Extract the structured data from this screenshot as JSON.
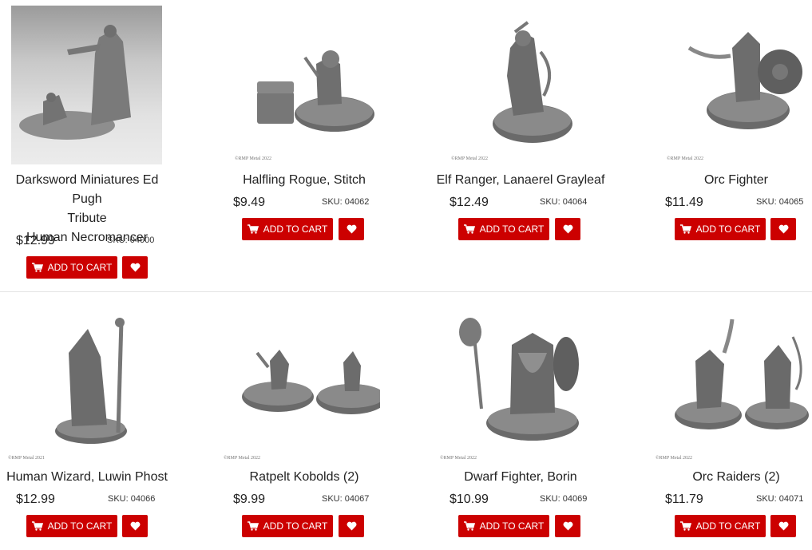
{
  "colors": {
    "button": "#cc0000",
    "text": "#222222",
    "divider": "#e3e3e3"
  },
  "button": {
    "add_to_cart": "ADD TO CART",
    "cart_icon": "cart-icon",
    "wish_icon": "heart-icon"
  },
  "products": [
    {
      "name_line1": "Darksword Miniatures Ed Pugh",
      "name_line2": "Tribute",
      "name_line3": "Human Necromancer",
      "price": "$12.99",
      "sku": "SKU: 04000",
      "copyright": ""
    },
    {
      "name_line1": "Halfling Rogue, Stitch",
      "price": "$9.49",
      "sku": "SKU: 04062",
      "copyright": "©RMP Metal 2022"
    },
    {
      "name_line1": "Elf Ranger, Lanaerel Grayleaf",
      "price": "$12.49",
      "sku": "SKU: 04064",
      "copyright": "©RMP Metal 2022"
    },
    {
      "name_line1": "Orc Fighter",
      "price": "$11.49",
      "sku": "SKU: 04065",
      "copyright": "©RMP Metal 2022"
    },
    {
      "name_line1": "Human Wizard, Luwin Phost",
      "price": "$12.99",
      "sku": "SKU: 04066",
      "copyright": "©RMP Metal 2021"
    },
    {
      "name_line1": "Ratpelt Kobolds (2)",
      "price": "$9.99",
      "sku": "SKU: 04067",
      "copyright": "©RMP Metal 2022"
    },
    {
      "name_line1": "Dwarf Fighter, Borin",
      "price": "$10.99",
      "sku": "SKU: 04069",
      "copyright": "©RMP Metal 2022"
    },
    {
      "name_line1": "Orc Raiders (2)",
      "price": "$11.79",
      "sku": "SKU: 04071",
      "copyright": "©RMP Metal 2022"
    }
  ]
}
